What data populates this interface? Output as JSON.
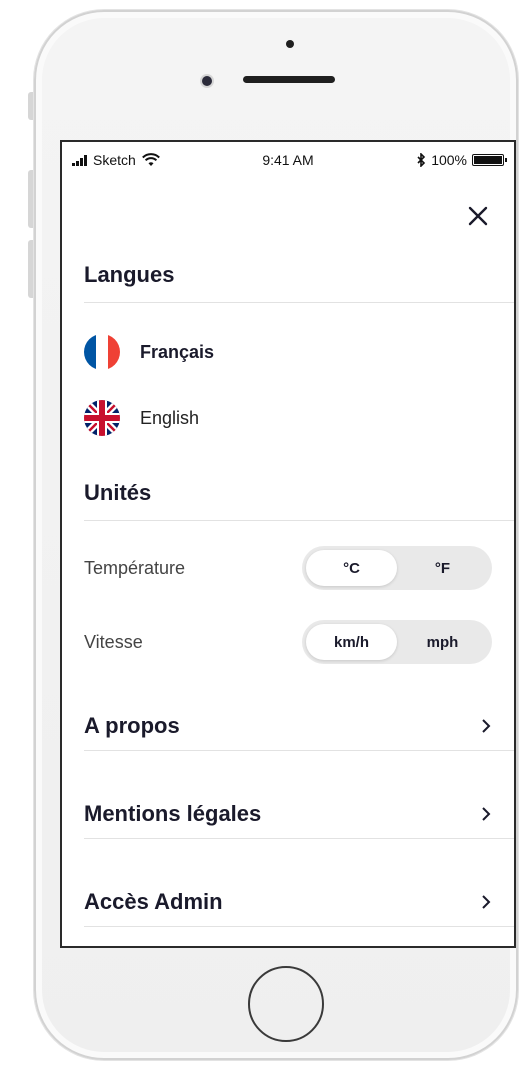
{
  "status_bar": {
    "carrier": "Sketch",
    "time": "9:41 AM",
    "battery": "100%",
    "battery_level": 1.0
  },
  "close_icon": "close-icon",
  "languages": {
    "title": "Langues",
    "items": [
      {
        "label": "Français",
        "flag": "france-flag-icon",
        "selected": true
      },
      {
        "label": "English",
        "flag": "uk-flag-icon",
        "selected": false
      }
    ]
  },
  "units": {
    "title": "Unités",
    "rows": [
      {
        "label": "Température",
        "options": [
          "°C",
          "°F"
        ],
        "selected": 0
      },
      {
        "label": "Vitesse",
        "options": [
          "km/h",
          "mph"
        ],
        "selected": 0
      }
    ]
  },
  "links": [
    {
      "label": "A propos"
    },
    {
      "label": "Mentions légales"
    },
    {
      "label": "Accès Admin"
    }
  ],
  "colors": {
    "title": "#1a1a2b",
    "divider": "#e2e2e2",
    "segment_bg": "#e9e9e9",
    "france_blue": "#0055a4",
    "france_red": "#ef4135",
    "uk_blue": "#012169",
    "uk_red": "#c8102e"
  }
}
